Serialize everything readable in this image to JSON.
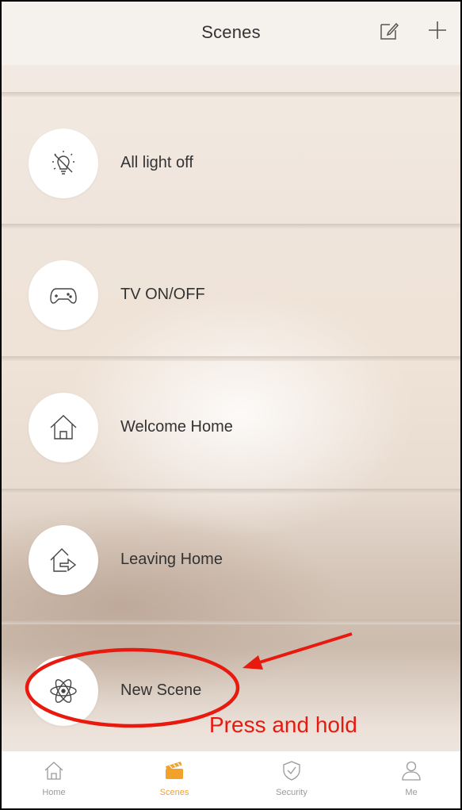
{
  "header": {
    "title": "Scenes"
  },
  "scenes": [
    {
      "label": "All light off",
      "icon": "light-off-icon"
    },
    {
      "label": "TV ON/OFF",
      "icon": "gamepad-icon"
    },
    {
      "label": "Welcome Home",
      "icon": "home-icon"
    },
    {
      "label": "Leaving Home",
      "icon": "leaving-home-icon"
    },
    {
      "label": "New Scene",
      "icon": "atom-icon"
    }
  ],
  "tabs": [
    {
      "label": "Home",
      "icon": "home-tab-icon",
      "active": false
    },
    {
      "label": "Scenes",
      "icon": "clapperboard-icon",
      "active": true
    },
    {
      "label": "Security",
      "icon": "shield-icon",
      "active": false
    },
    {
      "label": "Me",
      "icon": "person-icon",
      "active": false
    }
  ],
  "annotation": {
    "text": "Press and hold",
    "color": "#e8190f"
  },
  "colors": {
    "accent": "#f2a12b",
    "annotation": "#e8190f"
  }
}
